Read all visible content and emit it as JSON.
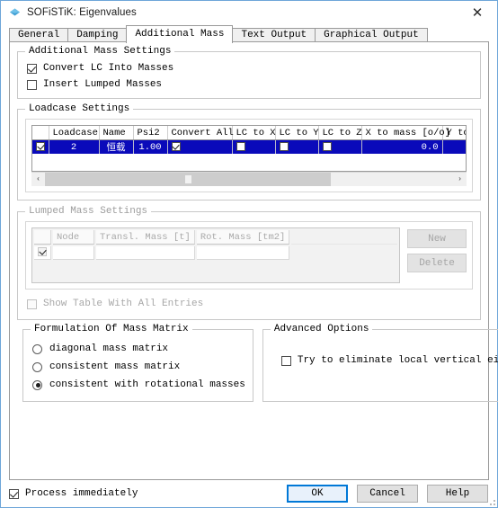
{
  "window": {
    "title": "SOFiSTiK: Eigenvalues",
    "icon": "sofistik-diamond-icon",
    "close_label": "✕",
    "accent": "#0078d7",
    "border_color": "#6ea6d9"
  },
  "tabs": [
    {
      "label": "General",
      "active": false
    },
    {
      "label": "Damping",
      "active": false
    },
    {
      "label": "Additional Mass",
      "active": true
    },
    {
      "label": "Text Output",
      "active": false
    },
    {
      "label": "Graphical Output",
      "active": false
    }
  ],
  "additional_mass_settings": {
    "title": "Additional Mass Settings",
    "options": [
      {
        "label": "Convert LC Into Masses",
        "checked": true
      },
      {
        "label": "Insert Lumped Masses",
        "checked": false
      }
    ]
  },
  "loadcase_settings": {
    "title": "Loadcase Settings",
    "columns": [
      "",
      "Loadcase",
      "Name",
      "Psi2",
      "Convert All",
      "LC to X",
      "LC to Y",
      "LC to Z",
      "X to mass [o/o]",
      "Y to m"
    ],
    "rows": [
      {
        "selected": true,
        "row_checked": true,
        "loadcase": "2",
        "name": "恒载",
        "psi2": "1.00",
        "convert_all": true,
        "lc_to_x": false,
        "lc_to_y": false,
        "lc_to_z": false,
        "x_to_mass": "0.0",
        "y_to_mass": ""
      }
    ],
    "scrollbar": {
      "left_arrow": "‹",
      "right_arrow": "›",
      "thumb_position_pct": 0,
      "thumb_width_pct": 70
    },
    "selected_row_color": "#0a0aba",
    "active_cell_color": "#1a93dd"
  },
  "lumped_mass_settings": {
    "title": "Lumped Mass Settings",
    "enabled": false,
    "columns": [
      "",
      "Node",
      "Transl. Mass [t]",
      "Rot. Mass [tm2]"
    ],
    "rows": [
      {
        "checked": true,
        "node": "",
        "transl_mass": "",
        "rot_mass": ""
      }
    ],
    "buttons": [
      {
        "label": "New",
        "enabled": false
      },
      {
        "label": "Delete",
        "enabled": false
      }
    ],
    "show_all_entries": {
      "label": "Show Table With All Entries",
      "checked": false,
      "enabled": false
    }
  },
  "formulation_of_mass_matrix": {
    "title": "Formulation Of Mass Matrix",
    "options": [
      {
        "label": "diagonal mass matrix",
        "selected": false
      },
      {
        "label": "consistent mass matrix",
        "selected": false
      },
      {
        "label": "consistent with rotational masses",
        "selected": true
      }
    ]
  },
  "advanced_options": {
    "title": "Advanced Options",
    "options": [
      {
        "label": "Try to eliminate local vertical eigenforms",
        "checked": false
      }
    ]
  },
  "footer": {
    "process_immediately": {
      "label": "Process immediately",
      "checked": true
    },
    "buttons": [
      {
        "label": "OK",
        "focused": true
      },
      {
        "label": "Cancel",
        "focused": false
      },
      {
        "label": "Help",
        "focused": false
      }
    ]
  }
}
